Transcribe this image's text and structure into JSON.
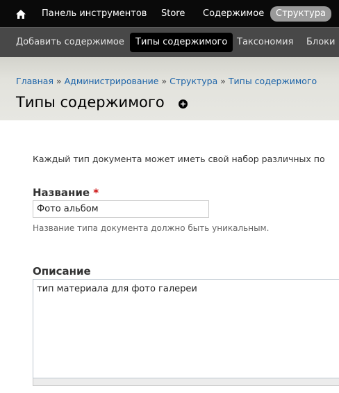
{
  "toolbar": {
    "home_icon": "home-icon",
    "items": [
      {
        "label": "Панель инструментов"
      },
      {
        "label": "Store"
      },
      {
        "label": "Содержимое"
      },
      {
        "label": "Структура",
        "active": true
      }
    ]
  },
  "shortcuts": {
    "items": [
      {
        "label": "Добавить содержимое"
      },
      {
        "label": "Типы содержимого",
        "active": true
      },
      {
        "label": "Таксономия"
      },
      {
        "label": "Блоки"
      }
    ]
  },
  "breadcrumb": {
    "items": [
      "Главная",
      "Администрирование",
      "Структура",
      "Типы содержимого"
    ],
    "separator": "»"
  },
  "page": {
    "title": "Типы содержимого",
    "add_icon": "plus-circle-icon"
  },
  "form": {
    "intro": "Каждый тип документа может иметь свой набор различных по",
    "name": {
      "label": "Название",
      "required_mark": "*",
      "value": "Фото альбом",
      "help": "Название типа документа должно быть уникальным."
    },
    "description": {
      "label": "Описание",
      "value": "тип материала для фото галереи"
    }
  },
  "colors": {
    "toolbar_bg": "#0a0a0a",
    "shortcuts_bg": "#484848",
    "active_tab_bg": "#9a9a9a",
    "link": "#1a62a8",
    "required": "#cc1111"
  }
}
